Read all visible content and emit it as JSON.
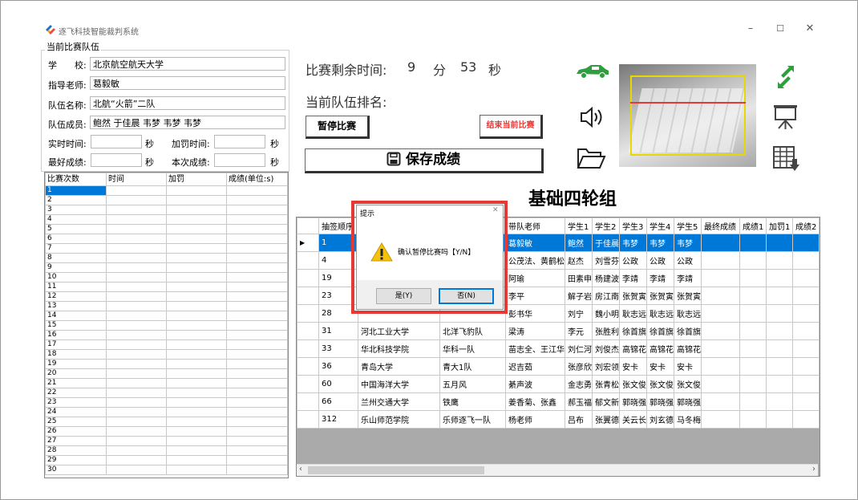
{
  "window": {
    "title": "逐飞科技智能裁判系统",
    "controls": {
      "minimize": "–",
      "maximize": "☐",
      "close": "✕"
    }
  },
  "team_group": {
    "title": "当前比赛队伍",
    "school_label": "学　　校:",
    "school": "北京航空航天大学",
    "teacher_label": "指导老师:",
    "teacher": "葛毅敏",
    "team_name_label": "队伍名称:",
    "team_name": "北航“火箭”二队",
    "members_label": "队伍成员:",
    "members": "鲍然 于佳晨 韦梦 韦梦 韦梦",
    "realtime_label": "实时时间:",
    "realtime": "",
    "penalty_time_label": "加罚时间:",
    "penalty_time": "",
    "best_label": "最好成绩:",
    "best": "",
    "current_label": "本次成绩:",
    "current": "",
    "sec": "秒"
  },
  "left_grid": {
    "columns": [
      "比赛次数",
      "时间",
      "加罚",
      "成绩(单位:s)"
    ],
    "rows": [
      "1",
      "2",
      "3",
      "4",
      "5",
      "6",
      "7",
      "8",
      "9",
      "10",
      "11",
      "12",
      "13",
      "14",
      "15",
      "16",
      "17",
      "18",
      "19",
      "20",
      "21",
      "22",
      "23",
      "24",
      "25",
      "26",
      "27",
      "28",
      "29",
      "30"
    ]
  },
  "timer": {
    "label": "比赛剩余时间:",
    "minutes": "9",
    "min_unit": "分",
    "seconds": "53",
    "sec_unit": "秒"
  },
  "rank_label": "当前队伍排名:",
  "buttons": {
    "pause": "暂停比赛",
    "end": "结束当前比赛",
    "save": "保存成绩"
  },
  "group_title": "基础四轮组",
  "right_grid": {
    "columns": [
      "抽签顺序",
      "",
      "",
      "带队老师",
      "学生1",
      "学生2",
      "学生3",
      "学生4",
      "学生5",
      "最终成绩",
      "成绩1",
      "加罚1",
      "成绩2"
    ],
    "rows": [
      [
        "1",
        "",
        "",
        "葛毅敏",
        "鲍然",
        "于佳晨",
        "韦梦",
        "韦梦",
        "韦梦",
        "",
        "",
        "",
        ""
      ],
      [
        "4",
        "",
        "",
        "公茂法、黄鹤松",
        "赵杰",
        "刘雪芬",
        "公政",
        "公政",
        "公政",
        "",
        "",
        "",
        ""
      ],
      [
        "19",
        "",
        "",
        "阿瑜",
        "田素申",
        "杨建波",
        "李靖",
        "李靖",
        "李靖",
        "",
        "",
        "",
        ""
      ],
      [
        "23",
        "",
        "",
        "李平",
        "解子岩",
        "房江南",
        "张贺寅",
        "张贺寅",
        "张贺寅",
        "",
        "",
        "",
        ""
      ],
      [
        "28",
        "",
        "",
        "彭书华",
        "刘宁",
        "魏小明",
        "耿志远",
        "耿志远",
        "耿志远",
        "",
        "",
        "",
        ""
      ],
      [
        "31",
        "河北工业大学",
        "北洋飞豹队",
        "梁涛",
        "李元",
        "张胜利",
        "徐首旗",
        "徐首旗",
        "徐首旗",
        "",
        "",
        "",
        ""
      ],
      [
        "33",
        "华北科技学院",
        "华科一队",
        "苗志全、王江华",
        "刘仁河",
        "刘俊杰",
        "高锦花",
        "高锦花",
        "高锦花",
        "",
        "",
        "",
        ""
      ],
      [
        "36",
        "青岛大学",
        "青大1队",
        "迟吉茹",
        "张彦欣",
        "刘宏领",
        "安卡",
        "安卡",
        "安卡",
        "",
        "",
        "",
        ""
      ],
      [
        "60",
        "中国海洋大学",
        "五月风",
        "綦声波",
        "金志勇",
        "张青松",
        "张文俊",
        "张文俊",
        "张文俊",
        "",
        "",
        "",
        ""
      ],
      [
        "66",
        "兰州交通大学",
        "铁鹰",
        "姜香菊、张鑫",
        "郝玉福",
        "郁文新",
        "郭晓强",
        "郭晓强",
        "郭晓强",
        "",
        "",
        "",
        ""
      ],
      [
        "312",
        "乐山师范学院",
        "乐师逐飞一队",
        "杨老师",
        "吕布",
        "张翼德",
        "关云长",
        "刘玄德",
        "马冬梅",
        "",
        "",
        "",
        ""
      ]
    ]
  },
  "dialog": {
    "title": "提示",
    "message": "确认暂停比赛吗【Y/N】",
    "yes": "是(Y)",
    "no": "否(N)",
    "close": "✕"
  },
  "icons": [
    "car-icon",
    "speaker-icon",
    "folder-icon",
    "camera-preview",
    "expand-arrows-icon",
    "presentation-icon",
    "table-download-icon"
  ],
  "colors": {
    "selection": "#0078d7",
    "highlight_border": "#e53935",
    "end_button_text": "#e53935",
    "icon_green": "#2e9e3e"
  }
}
